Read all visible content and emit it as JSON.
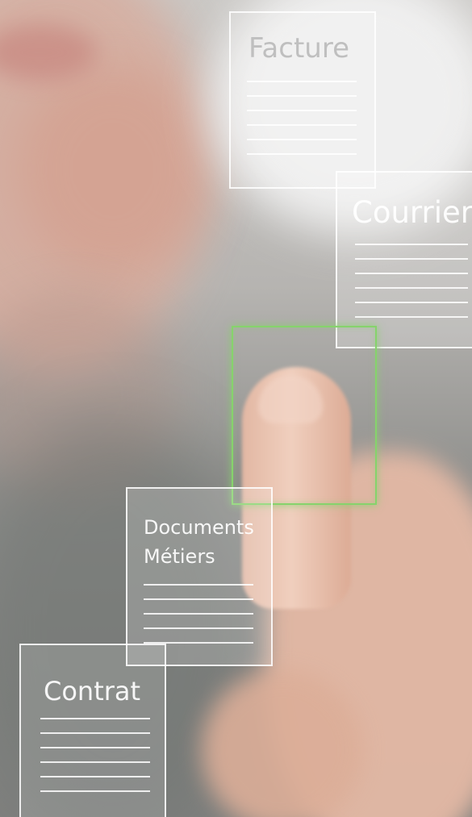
{
  "documents": {
    "facture": {
      "title": "Facture"
    },
    "courrier": {
      "title": "Courrier"
    },
    "metiers": {
      "line1": "Documents",
      "line2": "Métiers"
    },
    "contrat": {
      "title": "Contrat"
    }
  },
  "colors": {
    "highlight_frame": "#86d36c",
    "doc_stroke": "#ffffff"
  }
}
